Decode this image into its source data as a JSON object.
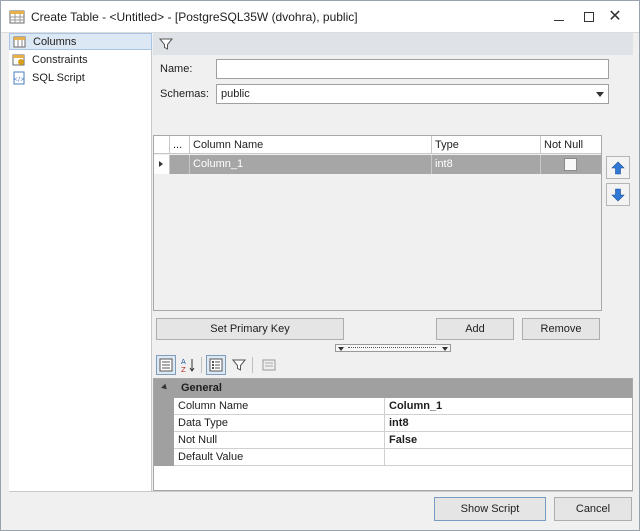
{
  "window": {
    "title": "Create Table - <Untitled> - [PostgreSQL35W (dvohra), public]",
    "icons": {
      "app": "table-icon",
      "minimize": "minimize-icon",
      "maximize": "maximize-icon",
      "close": "close-icon"
    },
    "close_glyph": "✕"
  },
  "sidebar": {
    "items": [
      {
        "label": "Columns",
        "icon": "columns-icon",
        "selected": true
      },
      {
        "label": "Constraints",
        "icon": "constraints-icon",
        "selected": false
      },
      {
        "label": "SQL Script",
        "icon": "sql-script-icon",
        "selected": false
      }
    ]
  },
  "form": {
    "name_label": "Name:",
    "name_value": "",
    "schemas_label": "Schemas:",
    "schemas_value": "public"
  },
  "columns_grid": {
    "headers": [
      "...",
      "Column Name",
      "Type",
      "Not Null"
    ],
    "rows": [
      {
        "column_name": "Column_1",
        "type": "int8",
        "not_null": false
      }
    ]
  },
  "buttons": {
    "set_primary_key": "Set Primary Key",
    "add": "Add",
    "remove": "Remove",
    "show_script": "Show Script",
    "cancel": "Cancel"
  },
  "properties": {
    "category": "General",
    "rows": [
      {
        "name": "Column Name",
        "value": "Column_1"
      },
      {
        "name": "Data Type",
        "value": "int8"
      },
      {
        "name": "Not Null",
        "value": "False"
      },
      {
        "name": "Default Value",
        "value": ""
      }
    ]
  },
  "colors": {
    "selected_row": "#a6a6a6",
    "accent_blue": "#1e6fd9",
    "category_bar": "#a0a0a0"
  }
}
